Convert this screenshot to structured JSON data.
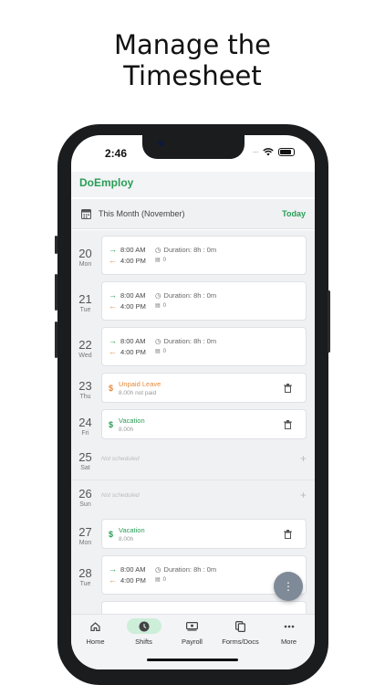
{
  "headline": {
    "line1": "Manage the",
    "line2": "Timesheet"
  },
  "status_bar": {
    "time": "2:46",
    "signal": "····"
  },
  "app": {
    "brand": "DoEmploy"
  },
  "period": {
    "label": "This Month (November)",
    "today_button": "Today"
  },
  "days": [
    {
      "num": "20",
      "weekday": "Mon",
      "type": "shift",
      "in": "8:00 AM",
      "out": "4:00 PM",
      "duration": "Duration: 8h : 0m",
      "notes": "0"
    },
    {
      "num": "21",
      "weekday": "Tue",
      "type": "shift",
      "in": "8:00 AM",
      "out": "4:00 PM",
      "duration": "Duration: 8h : 0m",
      "notes": "0"
    },
    {
      "num": "22",
      "weekday": "Wed",
      "type": "shift",
      "in": "8:00 AM",
      "out": "4:00 PM",
      "duration": "Duration: 8h : 0m",
      "notes": "0"
    },
    {
      "num": "23",
      "weekday": "Thu",
      "type": "leave",
      "title": "Unpaid Leave",
      "sub": "8.00h not paid",
      "color": "#e58a3a"
    },
    {
      "num": "24",
      "weekday": "Fri",
      "type": "leave",
      "title": "Vacation",
      "sub": "8.00h",
      "color": "#2a9d57"
    },
    {
      "num": "25",
      "weekday": "Sat",
      "type": "none",
      "text": "Not scheduled"
    },
    {
      "num": "26",
      "weekday": "Sun",
      "type": "none",
      "text": "Not scheduled"
    },
    {
      "num": "27",
      "weekday": "Mon",
      "type": "leave",
      "title": "Vacation",
      "sub": "8.00h",
      "color": "#2a9d57"
    },
    {
      "num": "28",
      "weekday": "Tue",
      "type": "shift",
      "in": "8:00 AM",
      "out": "4:00 PM",
      "duration": "Duration: 8h : 0m",
      "notes": "0"
    }
  ],
  "tabs": [
    {
      "label": "Home",
      "icon": "home-icon"
    },
    {
      "label": "Shifts",
      "icon": "clock-icon",
      "active": true
    },
    {
      "label": "Payroll",
      "icon": "payroll-icon"
    },
    {
      "label": "Forms/Docs",
      "icon": "documents-icon"
    },
    {
      "label": "More",
      "icon": "more-icon"
    }
  ],
  "colors": {
    "accent": "#2a9d57",
    "out_arrow": "#e58a3a",
    "fab": "#7f8a98"
  }
}
